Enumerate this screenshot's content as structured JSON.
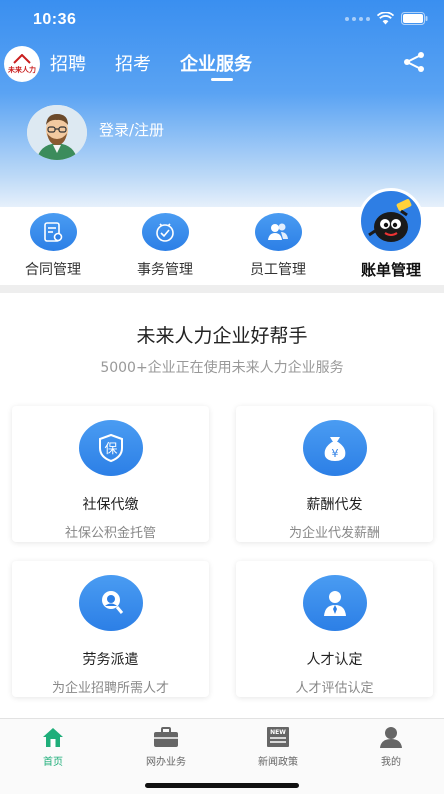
{
  "status": {
    "time": "10:36"
  },
  "nav": {
    "logo_text": "未来人力",
    "tabs": [
      {
        "label": "招聘"
      },
      {
        "label": "招考"
      },
      {
        "label": "企业服务"
      }
    ]
  },
  "profile": {
    "login_label": "登录/注册"
  },
  "quick": [
    {
      "label": "合同管理",
      "icon": "contract-icon"
    },
    {
      "label": "事务管理",
      "icon": "affairs-icon"
    },
    {
      "label": "员工管理",
      "icon": "employee-icon"
    },
    {
      "label": "账单管理",
      "icon": "bill-mascot"
    }
  ],
  "content": {
    "title": "未来人力企业好帮手",
    "subtitle": "5000+企业正在使用未来人力企业服务",
    "cards": [
      {
        "title": "社保代缴",
        "desc": "社保公积金托管",
        "icon_char": "保"
      },
      {
        "title": "薪酬代发",
        "desc": "为企业代发薪酬",
        "icon_char": "¥"
      },
      {
        "title": "劳务派遣",
        "desc": "为企业招聘所需人才"
      },
      {
        "title": "人才认定",
        "desc": "人才评估认定"
      }
    ]
  },
  "tabbar": [
    {
      "label": "首页",
      "active": true
    },
    {
      "label": "网办业务"
    },
    {
      "label": "新闻政策",
      "badge": "NEW"
    },
    {
      "label": "我的"
    }
  ],
  "colors": {
    "accent": "#2c7fe6",
    "tab_active": "#1fae7a"
  }
}
